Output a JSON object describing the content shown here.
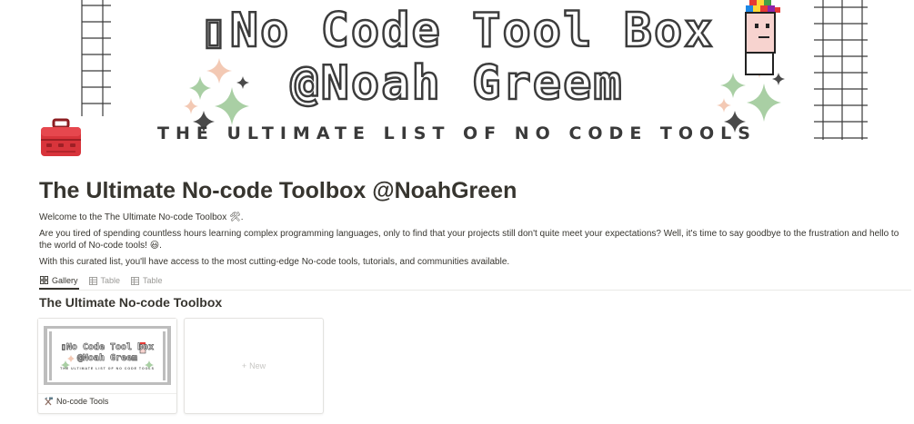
{
  "cover": {
    "title_line1": "▯No Code Tool Box",
    "title_line2": "@Noah Greem",
    "subtitle": "THE ULTIMATE LIST OF NO CODE TOOLS",
    "colors": {
      "outline": "#3c3c3c",
      "star_pink": "#f3c9b4",
      "star_green": "#a9cfa4",
      "star_dark": "#4a4a4a"
    }
  },
  "page": {
    "icon": "toolbox-icon",
    "title": "The Ultimate No-code Toolbox @NoahGreen",
    "intro": "Welcome to the The Ultimate No-code Toolbox 🛠.",
    "pitch": "Are you tired of spending countless hours learning complex programming languages, only to find that your projects still don't quite meet your expectations? Well, it's time to say goodbye to the frustration and hello to the world of No-code tools! 😃.",
    "access": "With this curated list, you'll have access to the most cutting-edge No-code tools, tutorials, and communities available."
  },
  "views": [
    {
      "label": "Gallery",
      "icon": "gallery-icon",
      "active": true
    },
    {
      "label": "Table",
      "icon": "table-icon",
      "active": false
    },
    {
      "label": "Table",
      "icon": "table-icon",
      "active": false
    }
  ],
  "database": {
    "title": "The Ultimate No-code Toolbox",
    "cards": [
      {
        "name": "No-code Tools",
        "icon": "hammer-pick-icon",
        "cover_line1": "▯No Code Tool box",
        "cover_line2": "@Noah Greem",
        "cover_subtitle": "THE ULTIMATE LIST OF NO CODE TOOLS"
      }
    ],
    "new_label": "New"
  }
}
